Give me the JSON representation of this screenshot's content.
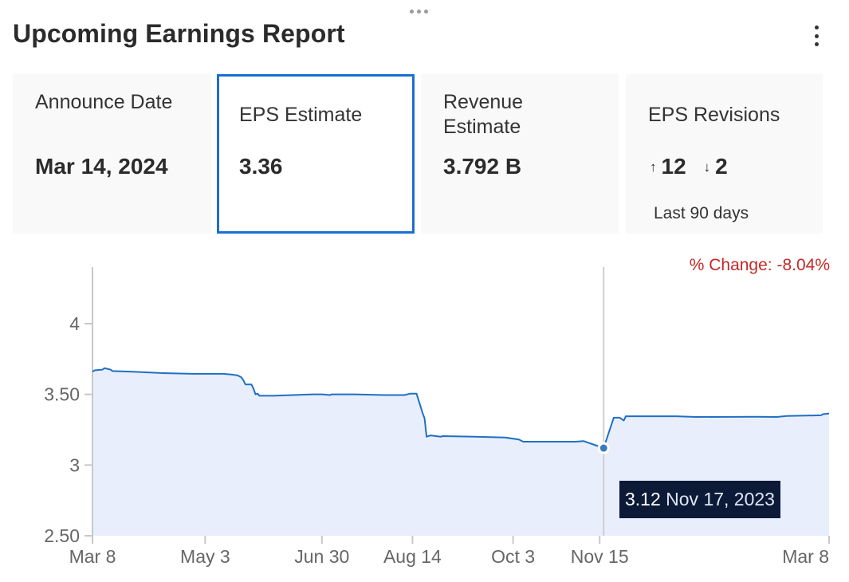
{
  "header": {
    "title": "Upcoming Earnings Report",
    "drag_handle_icon": "horizontal-ellipsis-icon",
    "menu_icon": "vertical-ellipsis-icon"
  },
  "cards": [
    {
      "label": "Announce Date",
      "value": "Mar 14, 2024",
      "active": false
    },
    {
      "label": "EPS Estimate",
      "value": "3.36",
      "active": true
    },
    {
      "label": "Revenue Estimate",
      "value": "3.792 B",
      "active": false
    },
    {
      "label": "EPS Revisions",
      "up_icon": "arrow-up-icon",
      "up_symbol": "↑",
      "up_count": "12",
      "down_icon": "arrow-down-icon",
      "down_symbol": "↓",
      "down_count": "2",
      "sub": "Last 90 days",
      "active": false
    }
  ],
  "colors": {
    "accent": "#1a6fd1",
    "line": "#1f6fc5",
    "area": "#e8eefb",
    "negative": "#c62828",
    "tooltip_bg": "#0c1a38"
  },
  "chart_data": {
    "type": "area",
    "title": "EPS Estimate",
    "xlabel": "",
    "ylabel": "",
    "percent_change_label": "% Change: -8.04%",
    "x_start": "Mar 8, 2023",
    "x_end": "Mar 8, 2024",
    "x_unit": "days since Mar 8, 2023",
    "xlim": [
      0,
      366
    ],
    "ylim": [
      2.5,
      4.4
    ],
    "grid": false,
    "x_ticks": [
      {
        "day": 0,
        "label": "Mar 8"
      },
      {
        "day": 56,
        "label": "May 3"
      },
      {
        "day": 114,
        "label": "Jun 30"
      },
      {
        "day": 159,
        "label": "Aug 14"
      },
      {
        "day": 209,
        "label": "Oct 3"
      },
      {
        "day": 252,
        "label": "Nov 15"
      },
      {
        "day": 366,
        "label": "Mar 8"
      }
    ],
    "y_ticks": [
      {
        "value": 2.5,
        "label": "2.50"
      },
      {
        "value": 3,
        "label": "3"
      },
      {
        "value": 3.5,
        "label": "3.50"
      },
      {
        "value": 4,
        "label": "4"
      }
    ],
    "series": [
      {
        "name": "EPS Estimate",
        "points": [
          [
            0,
            3.66
          ],
          [
            1,
            3.67
          ],
          [
            5,
            3.675
          ],
          [
            6,
            3.685
          ],
          [
            9,
            3.675
          ],
          [
            10,
            3.665
          ],
          [
            20,
            3.66
          ],
          [
            35,
            3.65
          ],
          [
            50,
            3.645
          ],
          [
            65,
            3.645
          ],
          [
            69,
            3.64
          ],
          [
            72,
            3.635
          ],
          [
            74,
            3.62
          ],
          [
            75,
            3.6
          ],
          [
            76,
            3.57
          ],
          [
            78,
            3.57
          ],
          [
            79,
            3.57
          ],
          [
            80,
            3.54
          ],
          [
            81,
            3.5
          ],
          [
            82,
            3.505
          ],
          [
            83,
            3.49
          ],
          [
            90,
            3.49
          ],
          [
            100,
            3.495
          ],
          [
            110,
            3.5
          ],
          [
            114,
            3.5
          ],
          [
            118,
            3.495
          ],
          [
            119,
            3.5
          ],
          [
            130,
            3.5
          ],
          [
            145,
            3.495
          ],
          [
            155,
            3.495
          ],
          [
            158,
            3.505
          ],
          [
            161,
            3.505
          ],
          [
            164,
            3.37
          ],
          [
            165,
            3.33
          ],
          [
            166,
            3.2
          ],
          [
            168,
            3.21
          ],
          [
            173,
            3.2
          ],
          [
            174,
            3.205
          ],
          [
            190,
            3.2
          ],
          [
            205,
            3.195
          ],
          [
            212,
            3.18
          ],
          [
            214,
            3.165
          ],
          [
            225,
            3.165
          ],
          [
            240,
            3.165
          ],
          [
            244,
            3.17
          ],
          [
            250,
            3.14
          ],
          [
            254,
            3.12
          ],
          [
            259,
            3.335
          ],
          [
            262,
            3.335
          ],
          [
            264,
            3.315
          ],
          [
            265,
            3.345
          ],
          [
            290,
            3.345
          ],
          [
            300,
            3.34
          ],
          [
            330,
            3.342
          ],
          [
            340,
            3.34
          ],
          [
            345,
            3.347
          ],
          [
            362,
            3.352
          ],
          [
            363,
            3.36
          ],
          [
            366,
            3.365
          ]
        ]
      }
    ],
    "highlight": {
      "day": 254,
      "value": 3.12,
      "value_label": "3.12",
      "date_label": "Nov 17, 2023"
    }
  }
}
